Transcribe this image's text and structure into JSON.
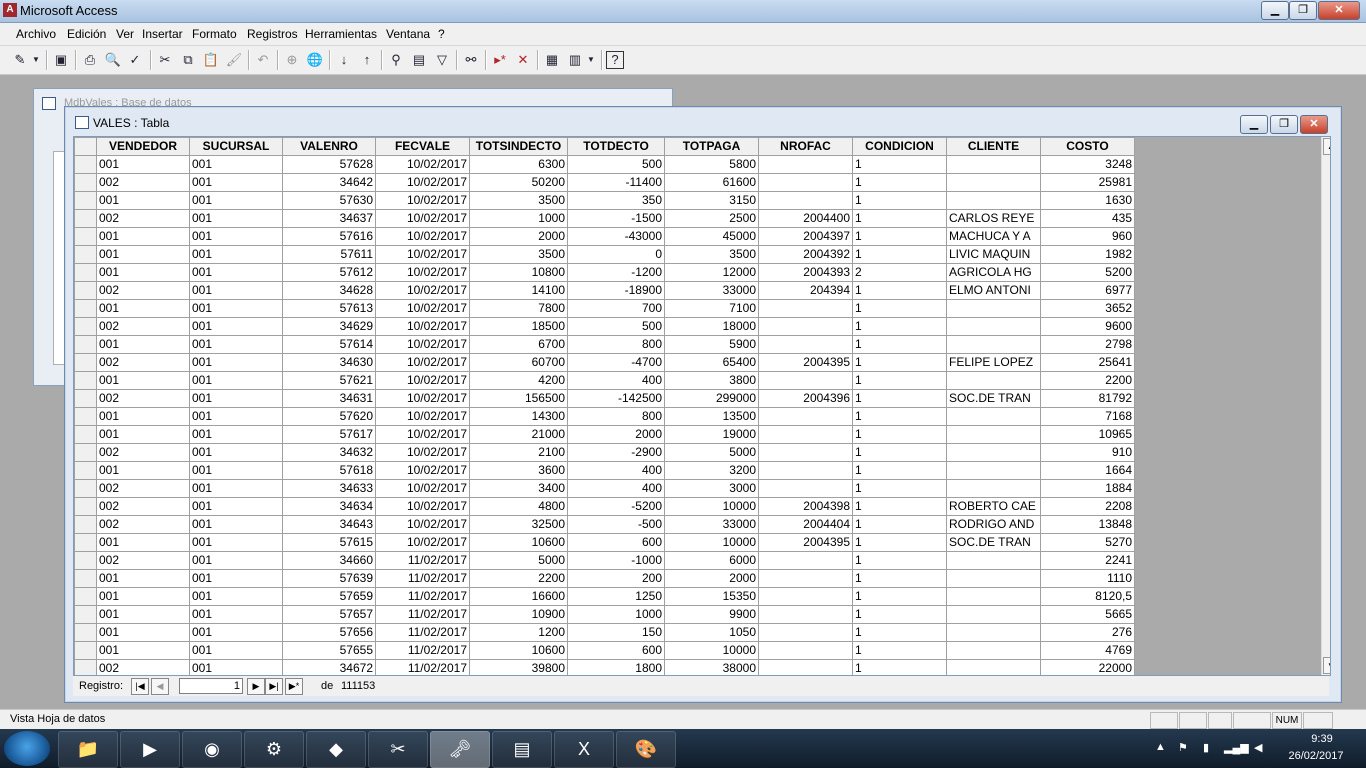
{
  "app": {
    "title": "Microsoft Access"
  },
  "menu": [
    "Archivo",
    "Edición",
    "Ver",
    "Insertar",
    "Formato",
    "Registros",
    "Herramientas",
    "Ventana",
    "?"
  ],
  "db_window": {
    "title": "MdbVales : Base de datos"
  },
  "table_window": {
    "title": "VALES : Tabla",
    "columns": [
      "VENDEDOR",
      "SUCURSAL",
      "VALENRO",
      "FECVALE",
      "TOTSINDECTO",
      "TOTDECTO",
      "TOTPAGA",
      "NROFAC",
      "CONDICION",
      "CLIENTE",
      "COSTO"
    ],
    "rows": [
      [
        "001",
        "001",
        "57628",
        "10/02/2017",
        "6300",
        "500",
        "5800",
        "",
        "1",
        "",
        "3248"
      ],
      [
        "002",
        "001",
        "34642",
        "10/02/2017",
        "50200",
        "-11400",
        "61600",
        "",
        "1",
        "",
        "25981"
      ],
      [
        "001",
        "001",
        "57630",
        "10/02/2017",
        "3500",
        "350",
        "3150",
        "",
        "1",
        "",
        "1630"
      ],
      [
        "002",
        "001",
        "34637",
        "10/02/2017",
        "1000",
        "-1500",
        "2500",
        "2004400",
        "1",
        "CARLOS REYE",
        "435"
      ],
      [
        "001",
        "001",
        "57616",
        "10/02/2017",
        "2000",
        "-43000",
        "45000",
        "2004397",
        "1",
        "MACHUCA Y A",
        "960"
      ],
      [
        "001",
        "001",
        "57611",
        "10/02/2017",
        "3500",
        "0",
        "3500",
        "2004392",
        "1",
        "LIVIC MAQUIN",
        "1982"
      ],
      [
        "001",
        "001",
        "57612",
        "10/02/2017",
        "10800",
        "-1200",
        "12000",
        "2004393",
        "2",
        "AGRICOLA HG",
        "5200"
      ],
      [
        "002",
        "001",
        "34628",
        "10/02/2017",
        "14100",
        "-18900",
        "33000",
        "204394",
        "1",
        "ELMO ANTONI",
        "6977"
      ],
      [
        "001",
        "001",
        "57613",
        "10/02/2017",
        "7800",
        "700",
        "7100",
        "",
        "1",
        "",
        "3652"
      ],
      [
        "002",
        "001",
        "34629",
        "10/02/2017",
        "18500",
        "500",
        "18000",
        "",
        "1",
        "",
        "9600"
      ],
      [
        "001",
        "001",
        "57614",
        "10/02/2017",
        "6700",
        "800",
        "5900",
        "",
        "1",
        "",
        "2798"
      ],
      [
        "002",
        "001",
        "34630",
        "10/02/2017",
        "60700",
        "-4700",
        "65400",
        "2004395",
        "1",
        "FELIPE LOPEZ",
        "25641"
      ],
      [
        "001",
        "001",
        "57621",
        "10/02/2017",
        "4200",
        "400",
        "3800",
        "",
        "1",
        "",
        "2200"
      ],
      [
        "002",
        "001",
        "34631",
        "10/02/2017",
        "156500",
        "-142500",
        "299000",
        "2004396",
        "1",
        "SOC.DE TRAN",
        "81792"
      ],
      [
        "001",
        "001",
        "57620",
        "10/02/2017",
        "14300",
        "800",
        "13500",
        "",
        "1",
        "",
        "7168"
      ],
      [
        "001",
        "001",
        "57617",
        "10/02/2017",
        "21000",
        "2000",
        "19000",
        "",
        "1",
        "",
        "10965"
      ],
      [
        "002",
        "001",
        "34632",
        "10/02/2017",
        "2100",
        "-2900",
        "5000",
        "",
        "1",
        "",
        "910"
      ],
      [
        "001",
        "001",
        "57618",
        "10/02/2017",
        "3600",
        "400",
        "3200",
        "",
        "1",
        "",
        "1664"
      ],
      [
        "002",
        "001",
        "34633",
        "10/02/2017",
        "3400",
        "400",
        "3000",
        "",
        "1",
        "",
        "1884"
      ],
      [
        "002",
        "001",
        "34634",
        "10/02/2017",
        "4800",
        "-5200",
        "10000",
        "2004398",
        "1",
        "ROBERTO CAE",
        "2208"
      ],
      [
        "002",
        "001",
        "34643",
        "10/02/2017",
        "32500",
        "-500",
        "33000",
        "2004404",
        "1",
        "RODRIGO AND",
        "13848"
      ],
      [
        "001",
        "001",
        "57615",
        "10/02/2017",
        "10600",
        "600",
        "10000",
        "2004395",
        "1",
        "SOC.DE TRAN",
        "5270"
      ],
      [
        "002",
        "001",
        "34660",
        "11/02/2017",
        "5000",
        "-1000",
        "6000",
        "",
        "1",
        "",
        "2241"
      ],
      [
        "001",
        "001",
        "57639",
        "11/02/2017",
        "2200",
        "200",
        "2000",
        "",
        "1",
        "",
        "1110"
      ],
      [
        "001",
        "001",
        "57659",
        "11/02/2017",
        "16600",
        "1250",
        "15350",
        "",
        "1",
        "",
        "8120,5"
      ],
      [
        "001",
        "001",
        "57657",
        "11/02/2017",
        "10900",
        "1000",
        "9900",
        "",
        "1",
        "",
        "5665"
      ],
      [
        "001",
        "001",
        "57656",
        "11/02/2017",
        "1200",
        "150",
        "1050",
        "",
        "1",
        "",
        "276"
      ],
      [
        "001",
        "001",
        "57655",
        "11/02/2017",
        "10600",
        "600",
        "10000",
        "",
        "1",
        "",
        "4769"
      ],
      [
        "002",
        "001",
        "34672",
        "11/02/2017",
        "39800",
        "1800",
        "38000",
        "",
        "1",
        "",
        "22000"
      ]
    ],
    "navigator": {
      "label": "Registro:",
      "current": "1",
      "of": "de",
      "total": "111153"
    }
  },
  "status": {
    "text": "Vista Hoja de datos",
    "num": "NUM"
  },
  "taskbar": {
    "time": "9:39",
    "date": "26/02/2017"
  }
}
